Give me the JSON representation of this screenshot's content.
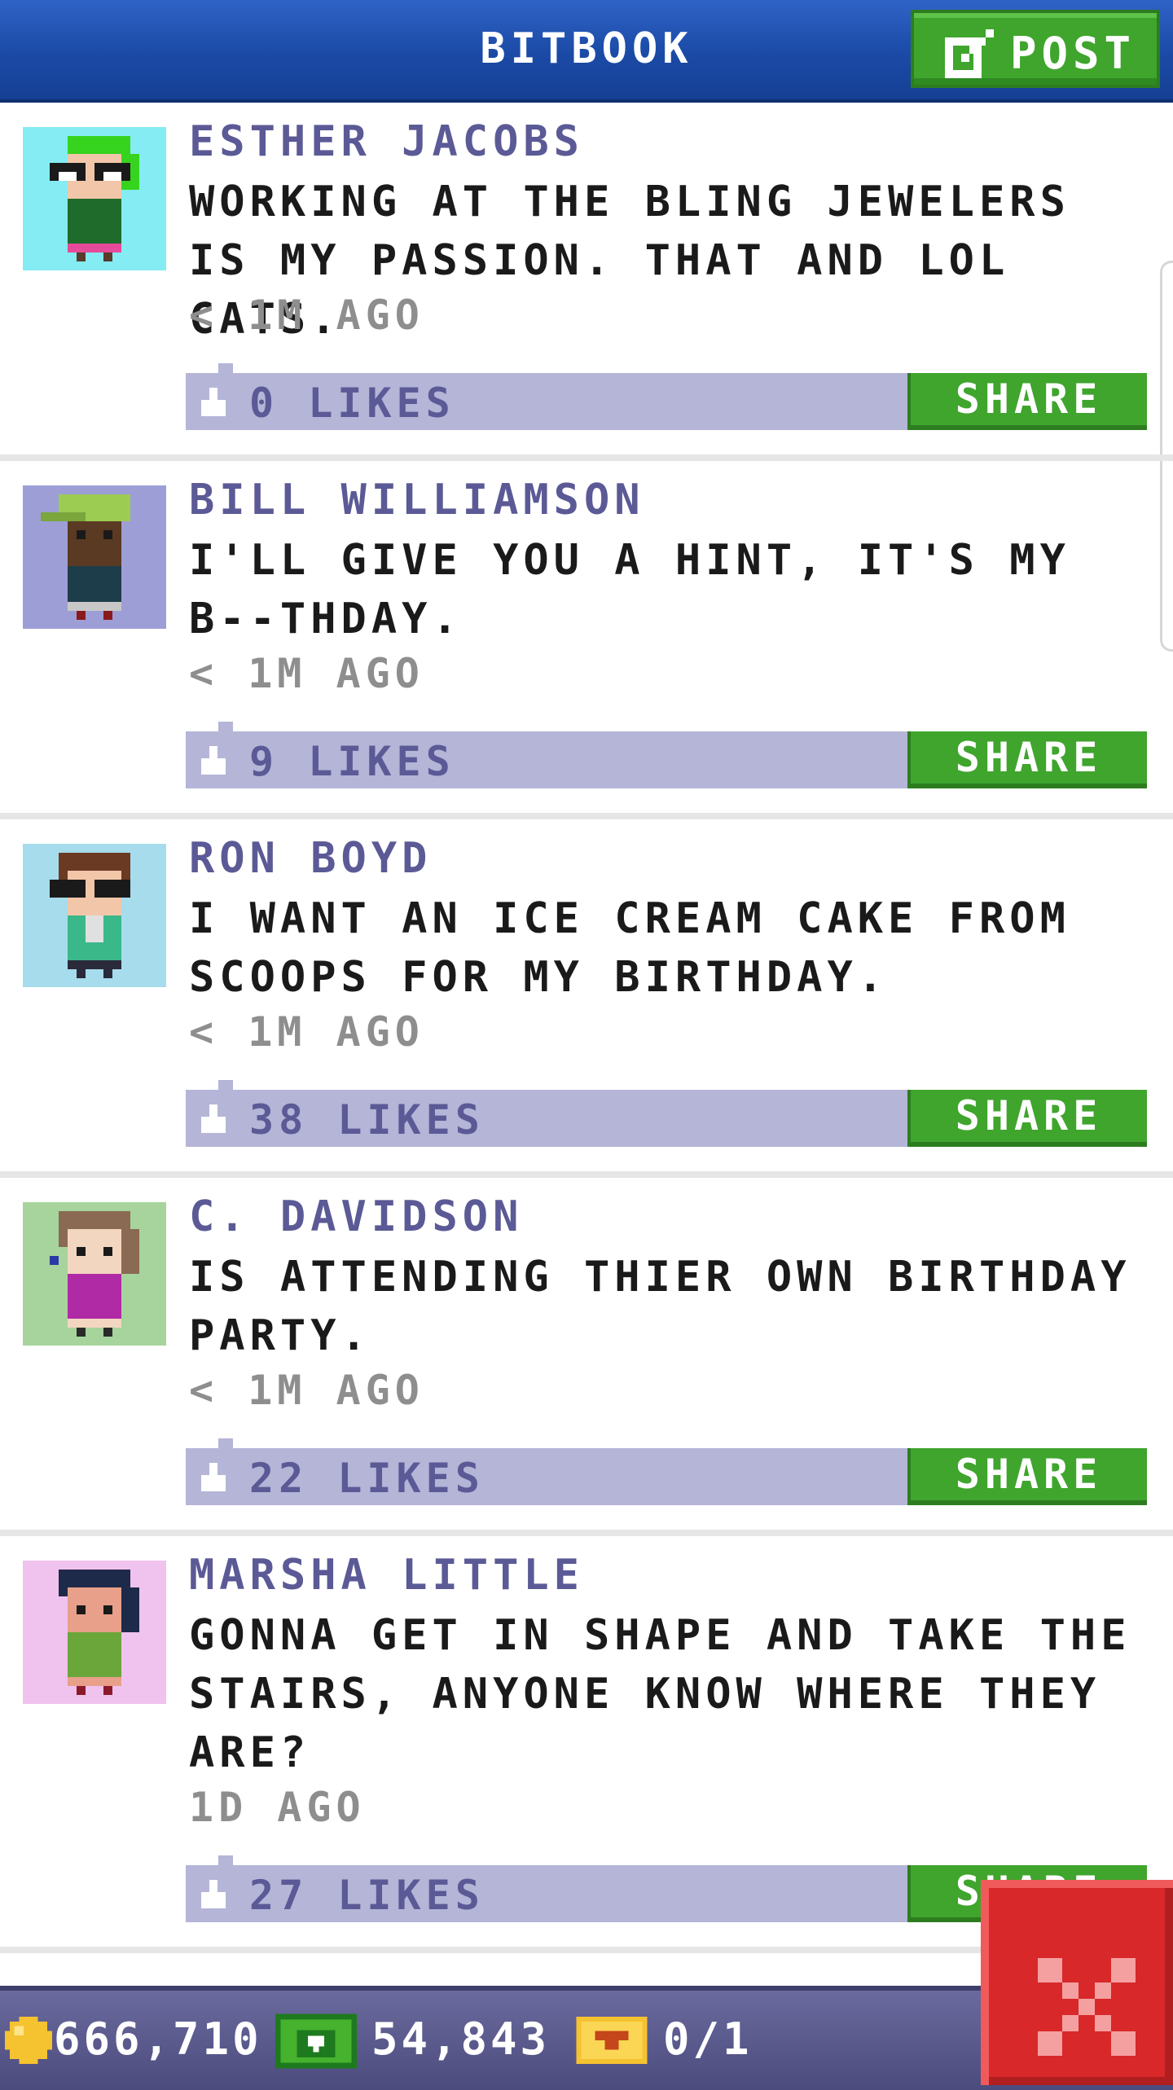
{
  "header": {
    "title": "BITBOOK",
    "post_label": "POST"
  },
  "posts": [
    {
      "author": "ESTHER JACOBS",
      "message": "WORKING AT THE BLING JEWELERS IS MY PASSION. THAT AND LOL CATS.",
      "time": "< 1M AGO",
      "likes": "0 LIKES",
      "share_label": "SHARE",
      "avatar_bg": "#84ecf2"
    },
    {
      "author": "BILL WILLIAMSON",
      "message": "I'LL GIVE YOU A HINT, IT'S MY B--THDAY.",
      "time": "< 1M AGO",
      "likes": "9 LIKES",
      "share_label": "SHARE",
      "avatar_bg": "#9e9ed6"
    },
    {
      "author": "RON BOYD",
      "message": "I WANT AN ICE CREAM CAKE FROM SCOOPS FOR MY BIRTHDAY.",
      "time": "< 1M AGO",
      "likes": "38 LIKES",
      "share_label": "SHARE",
      "avatar_bg": "#a6dcec"
    },
    {
      "author": "C. DAVIDSON",
      "message": "IS ATTENDING THIER OWN BIRTHDAY PARTY.",
      "time": "< 1M AGO",
      "likes": "22 LIKES",
      "share_label": "SHARE",
      "avatar_bg": "#a6d49c"
    },
    {
      "author": "MARSHA LITTLE",
      "message": "GONNA GET IN SHAPE AND TAKE THE STAIRS, ANYONE KNOW WHERE THEY ARE?",
      "time": "1D AGO",
      "likes": "27 LIKES",
      "share_label": "SHARE",
      "avatar_bg": "#f0c2ee"
    }
  ],
  "footer": {
    "coins": "666,710",
    "bux": "54,843",
    "tickets": "0/1"
  },
  "colors": {
    "accent_green": "#3fa52d",
    "header_blue": "#1b4aa6",
    "like_bar": "#b4b5d7",
    "name_purple": "#5b5a96",
    "close_red": "#d8282a"
  }
}
